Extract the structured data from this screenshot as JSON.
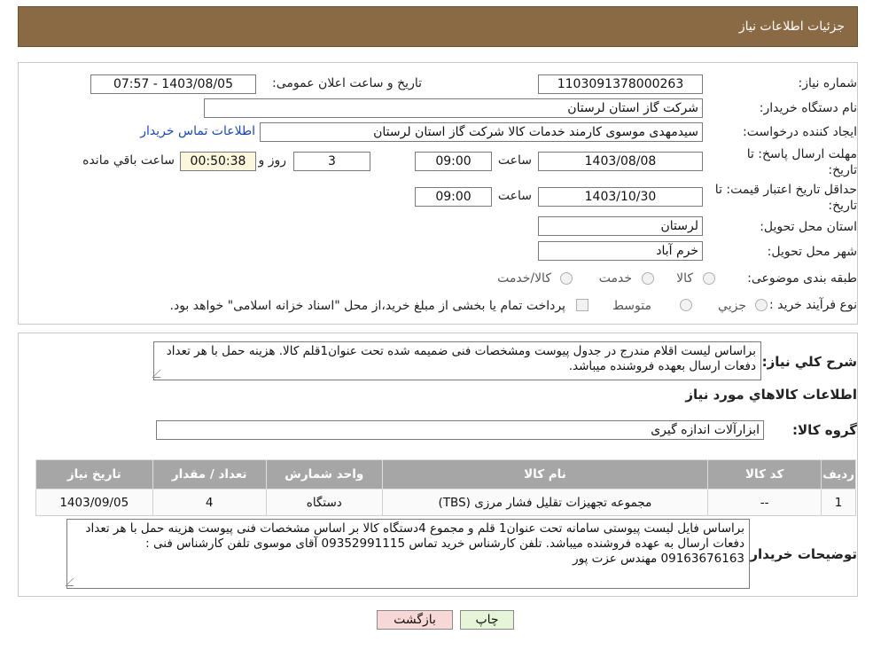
{
  "header": {
    "title": "جزئیات اطلاعات نیاز"
  },
  "form": {
    "need_number_label": "شماره نیاز:",
    "need_number": "1103091378000263",
    "announce_label": "تاریخ و ساعت اعلان عمومی:",
    "announce_value": "1403/08/05 - 07:57",
    "buyer_org_label": "نام دستگاه خریدار:",
    "buyer_org": "شرکت گاز استان لرستان",
    "creator_label": "ایجاد کننده درخواست:",
    "creator": "سیدمهدی موسوی کارمند خدمات کالا شرکت گاز استان لرستان",
    "contact_link": "اطلاعات تماس خریدار",
    "reply_deadline_label_1": "مهلت ارسال پاسخ: تا",
    "reply_deadline_label_2": "تاریخ:",
    "reply_date": "1403/08/08",
    "time_label": "ساعت",
    "reply_time": "09:00",
    "days": "3",
    "days_label": "روز و",
    "remaining_time": "00:50:38",
    "remaining_label": "ساعت باقي مانده",
    "price_validity_label_1": "حداقل تاریخ اعتبار قیمت: تا",
    "price_validity_label_2": "تاریخ:",
    "price_validity_date": "1403/10/30",
    "price_validity_time": "09:00",
    "province_label": "استان محل تحویل:",
    "province": "لرستان",
    "city_label": "شهر محل تحویل:",
    "city": "خرم آباد",
    "category_label": "طبقه بندی موضوعی:",
    "category_options": [
      "کالا",
      "خدمت",
      "کالا/خدمت"
    ],
    "process_label": "نوع فرآیند خرید :",
    "process_options": [
      "جزیي",
      "متوسط"
    ],
    "payment_note": "پرداخت تمام یا بخشی از مبلغ خرید،از محل \"اسناد خزانه اسلامی\" خواهد بود."
  },
  "details": {
    "summary_label": "شرح کلي نياز:",
    "summary": "براساس لیست اقلام مندرج در جدول پیوست ومشخصات فنی ضمیمه شده تحت عنوان1قلم کالا. هزینه حمل با هر تعداد دفعات ارسال بعهده فروشنده میباشد.",
    "goods_info_title": "اطلاعات کالاهاي مورد نياز",
    "goods_group_label": "گروه کالا:",
    "goods_group": "ابزارآلات اندازه گیری",
    "table": {
      "headers": [
        "رديف",
        "کد کالا",
        "نام کالا",
        "واحد شمارش",
        "تعداد / مقدار",
        "تاریخ نیاز"
      ],
      "rows": [
        [
          "1",
          "--",
          "مجموعه تجهیزات تقلیل فشار مرزی (TBS)",
          "دستگاه",
          "4",
          "1403/09/05"
        ]
      ]
    },
    "buyer_notes_label": "توضيحات خريدار:",
    "buyer_notes": "براساس  فایل لیست پیوستی سامانه تحت عنوان1 قلم و مجموع 4دستگاه کالا بر اساس مشخصات فنی پیوست هزینه حمل با هر تعداد دفعات ارسال به عهده فروشنده میباشد. تلفن کارشناس خرید تماس 09352991115 آقای موسوی تلفن کارشناس فنی : 09163676163 مهندس عزت پور"
  },
  "buttons": {
    "print": "چاپ",
    "back": "بازگشت"
  },
  "colors": {
    "header": "#8a6a45",
    "table_header": "#a6a6a6",
    "back_button": "#f8d7d7",
    "print_button": "#e6f5d7"
  }
}
